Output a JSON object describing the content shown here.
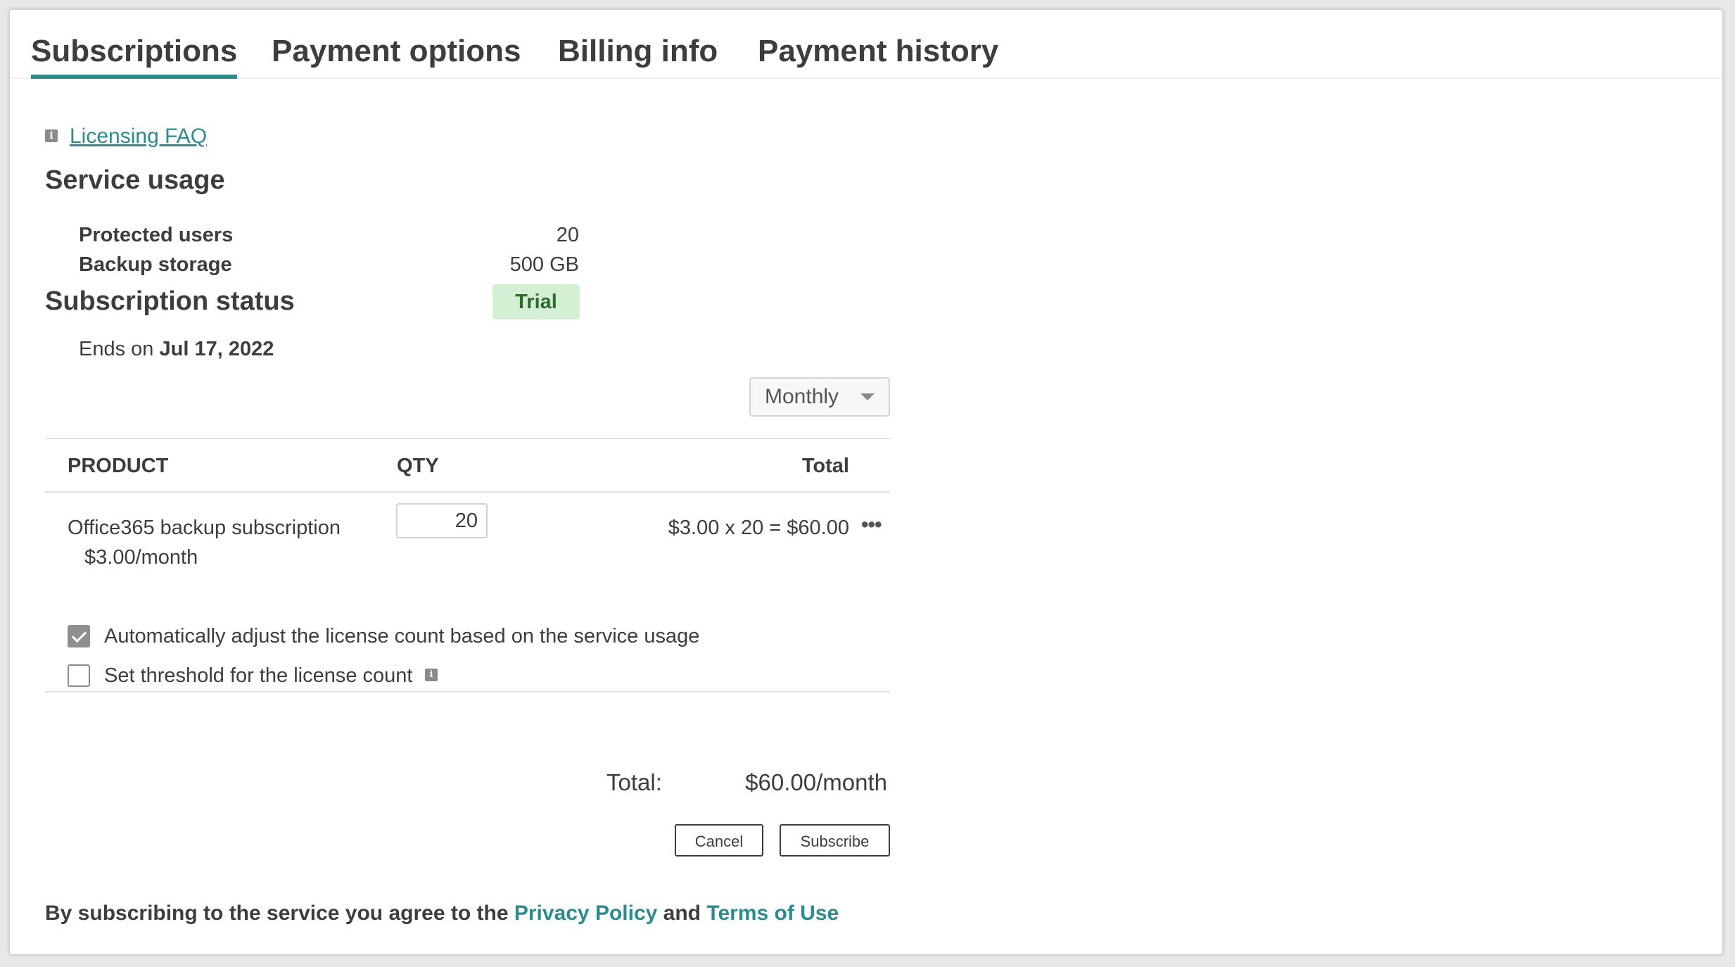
{
  "tabs": [
    {
      "label": "Subscriptions",
      "active": true
    },
    {
      "label": "Payment options",
      "active": false
    },
    {
      "label": "Billing info",
      "active": false
    },
    {
      "label": "Payment history",
      "active": false
    }
  ],
  "faq": {
    "icon": "info-icon",
    "label": "Licensing FAQ"
  },
  "service_usage": {
    "title": "Service usage",
    "rows": [
      {
        "label": "Protected users",
        "value": "20"
      },
      {
        "label": "Backup storage",
        "value": "500 GB"
      }
    ]
  },
  "subscription_status": {
    "title": "Subscription status",
    "badge": "Trial",
    "badge_color": "#d4f0d4",
    "ends_prefix": "Ends on",
    "ends_date": "Jul 17, 2022"
  },
  "billing_period": {
    "selected": "Monthly"
  },
  "table": {
    "headers": {
      "product": "PRODUCT",
      "qty": "QTY",
      "total": "Total"
    },
    "rows": [
      {
        "product": "Office365 backup subscription",
        "price": "$3.00/month",
        "qty": "20",
        "total": "$3.00 x 20 = $60.00"
      }
    ]
  },
  "options": {
    "auto_adjust": {
      "label": "Automatically adjust the license count based on the service usage",
      "checked": true
    },
    "threshold": {
      "label": "Set threshold for the license count",
      "checked": false
    }
  },
  "summary": {
    "total_label": "Total:",
    "total_value": "$60.00/month"
  },
  "buttons": {
    "cancel": "Cancel",
    "subscribe": "Subscribe"
  },
  "footer": {
    "prefix": "By subscribing to the service you agree to the",
    "privacy": "Privacy Policy",
    "and": "and",
    "terms": "Terms of Use"
  },
  "colors": {
    "accent": "#2e8b8b"
  }
}
